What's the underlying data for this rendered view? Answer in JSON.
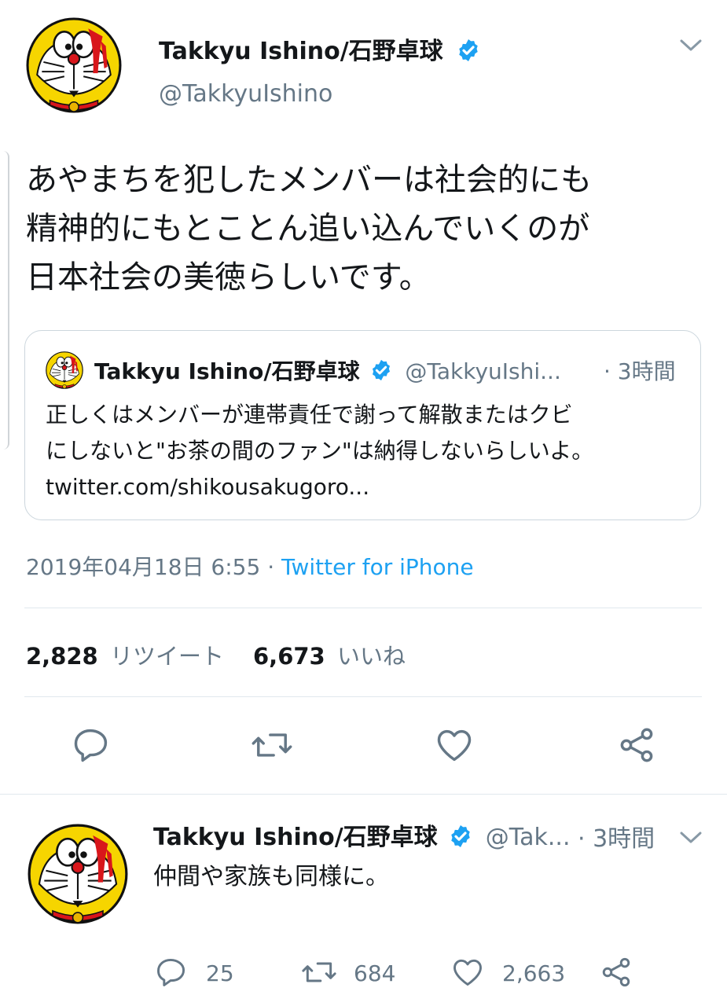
{
  "main_tweet": {
    "author_name": "Takkyu Ishino/石野卓球",
    "author_handle": "@TakkyuIshino",
    "text_lines": [
      "あやまちを犯したメンバーは社会的にも",
      "精神的にもとことん追い込んでいくのが",
      "日本社会の美徳らしいです。"
    ],
    "quoted": {
      "author_name": "Takkyu Ishino/石野卓球",
      "author_handle": "@TakkyuIshi...",
      "time": "· 3時間",
      "text_lines": [
        "正しくはメンバーが連帯責任で謝って解散またはクビ",
        "にしないと\"お茶の間のファン\"は納得しないらしいよ。",
        "twitter.com/shikousakugoro..."
      ]
    },
    "timestamp": "2019年04月18日 6:55 · ",
    "source": "Twitter for iPhone",
    "retweet_count": "2,828",
    "retweet_label": "リツイート",
    "like_count": "6,673",
    "like_label": "いいね"
  },
  "reply_tweet": {
    "author_name": "Takkyu Ishino/石野卓球",
    "author_handle": "@Tak...",
    "time": "· 3時間",
    "text": "仲間や家族も同様に。",
    "reply_count": "25",
    "retweet_count": "684",
    "like_count": "2,663"
  },
  "icons": {
    "menu": "chevron-down-icon",
    "verified": "verified-badge-icon",
    "reply": "reply-icon",
    "retweet": "retweet-icon",
    "like": "heart-icon",
    "share": "share-icon"
  },
  "colors": {
    "accent": "#1da1f2",
    "secondary_text": "#657786",
    "divider": "#e1e8ed"
  }
}
